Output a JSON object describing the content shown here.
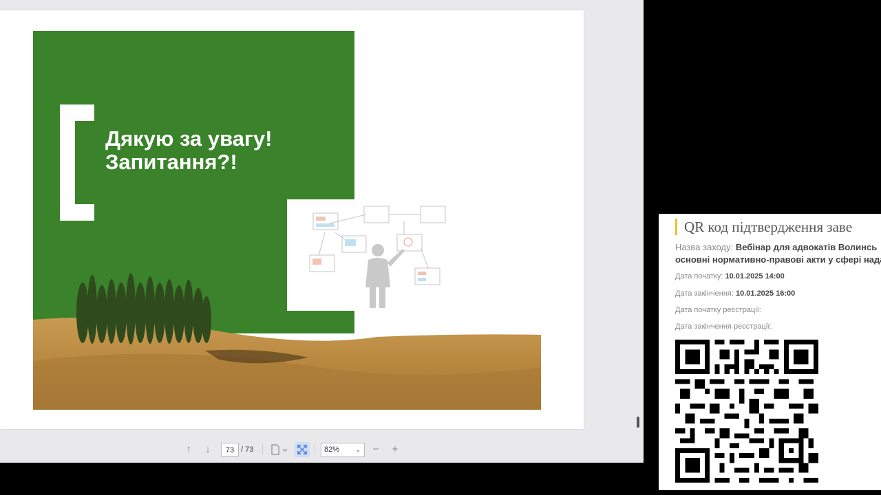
{
  "slide": {
    "title_line1": "Дякую за увагу!",
    "title_line2": "Запитання?!",
    "accent_color": "#3a832b"
  },
  "toolbar": {
    "prev_icon": "arrow-up-icon",
    "next_icon": "arrow-down-icon",
    "page_current": "73",
    "page_total": "/ 73",
    "zoom_value": "82%",
    "zoom_out_label": "−",
    "zoom_in_label": "+"
  },
  "qr_panel": {
    "header": "QR код підтвердження заве",
    "event_name_label": "Назва заходу:",
    "event_name_value": "Вебінар для адвокатів Волинсь",
    "event_name_value_line2": "основні нормативно-правові акти у сфері нада",
    "start_label": "Дата початку:",
    "start_value": "10.01.2025 14:00",
    "end_label": "Дата закінчення:",
    "end_value": "10.01.2025 16:00",
    "reg_start_label": "Дата початку реєстрації:",
    "reg_end_label": "Дата закінчення реєстрації:",
    "accent_color": "#e8c22c"
  }
}
